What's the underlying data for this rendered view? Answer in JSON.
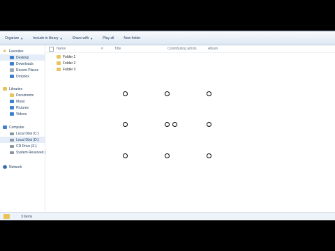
{
  "toolbar": {
    "items": [
      {
        "label": "Organize",
        "dropdown": true
      },
      {
        "label": "Include in library",
        "dropdown": true
      },
      {
        "label": "Share with",
        "dropdown": true
      },
      {
        "label": "Play all",
        "dropdown": false
      },
      {
        "label": "New folder",
        "dropdown": false
      }
    ]
  },
  "nav": {
    "favorites": {
      "label": "Favorites",
      "items": [
        "Desktop",
        "Downloads",
        "Recent Places",
        "Dropbox"
      ]
    },
    "libraries": {
      "label": "Libraries",
      "items": [
        "Documents",
        "Music",
        "Pictures",
        "Videos"
      ]
    },
    "computer": {
      "label": "Computer",
      "items": [
        "Local Disk (C:)",
        "Local Disk (D:)",
        "CD Drive (E:)",
        "System Reserved (H:)"
      ]
    },
    "network": {
      "label": "Network"
    }
  },
  "columns": {
    "name": "Name",
    "hash": "#",
    "title": "Title",
    "contributing_artists": "Contributing artists",
    "album": "Album"
  },
  "files": [
    "Folder 1",
    "Folder 2",
    "Folder 3"
  ],
  "status": {
    "item_count": "3 items"
  }
}
